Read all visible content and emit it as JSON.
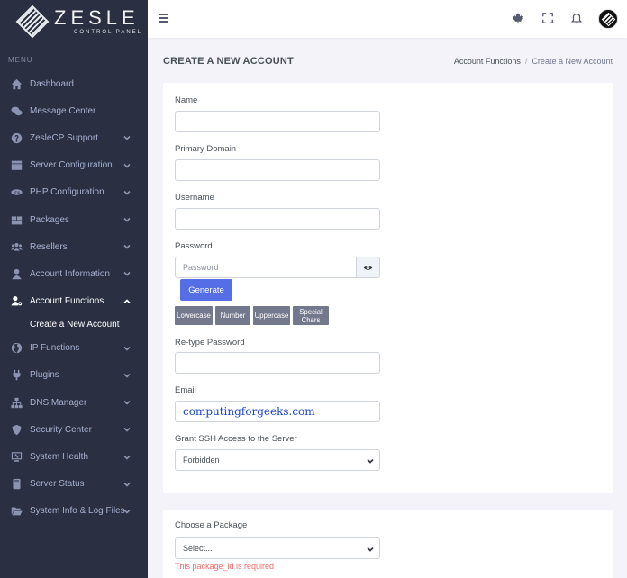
{
  "brand": {
    "name": "ZESLE",
    "subtitle": "CONTROL PANEL"
  },
  "sidebar": {
    "menu_title": "MENU",
    "items": [
      {
        "label": "Dashboard",
        "icon": "home-icon",
        "chevron": false
      },
      {
        "label": "Message Center",
        "icon": "chat-icon",
        "chevron": false
      },
      {
        "label": "ZesleCP Support",
        "icon": "help-circle-icon",
        "chevron": true
      },
      {
        "label": "Server Configuration",
        "icon": "server-icon",
        "chevron": true
      },
      {
        "label": "PHP Configuration",
        "icon": "php-icon",
        "chevron": true
      },
      {
        "label": "Packages",
        "icon": "package-icon",
        "chevron": true
      },
      {
        "label": "Resellers",
        "icon": "users-icon",
        "chevron": true
      },
      {
        "label": "Account Information",
        "icon": "user-icon",
        "chevron": true
      },
      {
        "label": "Account Functions",
        "icon": "user-cog-icon",
        "chevron": true,
        "active": true
      },
      {
        "label": "IP Functions",
        "icon": "globe-icon",
        "chevron": true
      },
      {
        "label": "Plugins",
        "icon": "plug-icon",
        "chevron": true
      },
      {
        "label": "DNS Manager",
        "icon": "network-icon",
        "chevron": true
      },
      {
        "label": "Security Center",
        "icon": "shield-icon",
        "chevron": true
      },
      {
        "label": "System Health",
        "icon": "monitor-icon",
        "chevron": true
      },
      {
        "label": "Server Status",
        "icon": "database-icon",
        "chevron": true
      },
      {
        "label": "System Info & Log Files",
        "icon": "folder-open-icon",
        "chevron": true
      }
    ],
    "active_sub": "Create a New Account"
  },
  "header": {
    "icons": [
      "menu-icon",
      "maple-leaf-icon",
      "fullscreen-icon",
      "bell-icon",
      "avatar"
    ]
  },
  "page": {
    "title": "CREATE A NEW ACCOUNT",
    "breadcrumb": {
      "parent": "Account Functions",
      "separator": "/",
      "current": "Create a New Account"
    }
  },
  "form": {
    "name_label": "Name",
    "name_value": "",
    "domain_label": "Primary Domain",
    "domain_value": "",
    "username_label": "Username",
    "username_value": "",
    "password_label": "Password",
    "password_placeholder": "Password",
    "generate_label": "Generate",
    "chips": [
      "Lowercase",
      "Number",
      "Uppercase",
      "Special Chars"
    ],
    "retype_label": "Re-type Password",
    "retype_value": "",
    "email_label": "Email",
    "email_value": "computingforgeeks.com",
    "ssh_label": "Grant SSH Access to the Server",
    "ssh_value": "Forbidden",
    "package_label": "Choose a Package",
    "package_value": "Select...",
    "package_error": "This package_id is required"
  },
  "colors": {
    "sidebar_bg": "#2a3042",
    "primary": "#556ee6",
    "chip": "#74788d",
    "error": "#f46a6a"
  }
}
